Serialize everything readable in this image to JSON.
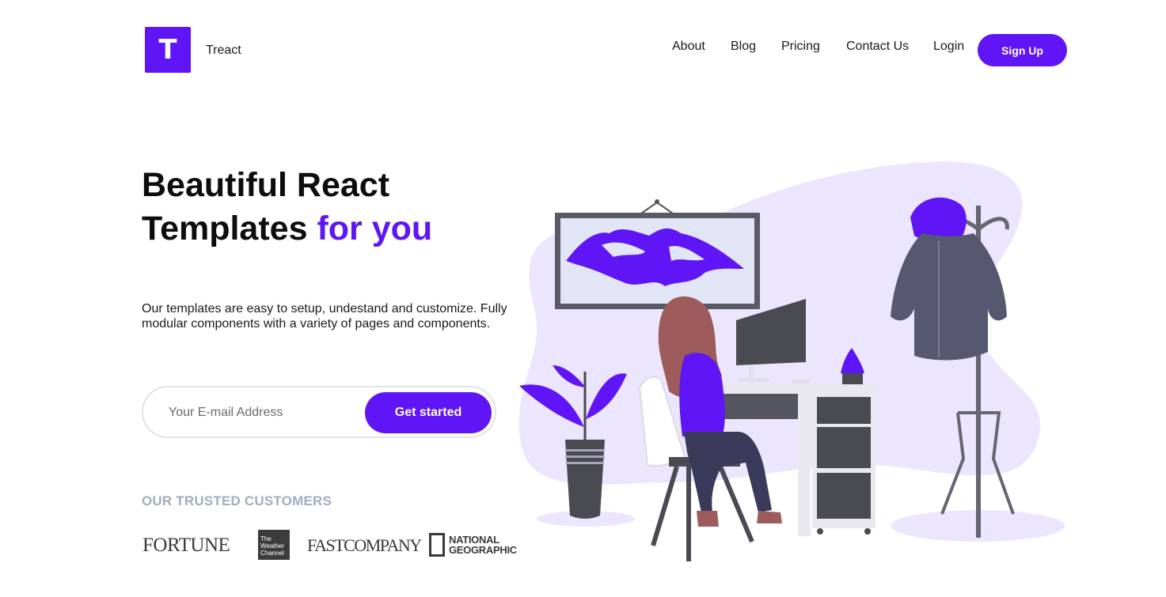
{
  "brand": {
    "logo_letter": "T",
    "name": "Treact"
  },
  "nav": {
    "links": [
      "About",
      "Blog",
      "Pricing",
      "Contact Us",
      "Login"
    ],
    "signup_label": "Sign Up"
  },
  "hero": {
    "title_line1": "Beautiful React",
    "title_line2_plain": "Templates ",
    "title_line2_accent": "for you",
    "description": "Our templates are easy to setup, undestand and customize. Fully modular components with a variety of pages and components.",
    "email_placeholder": "Your E-mail Address",
    "cta_label": "Get started"
  },
  "customers": {
    "heading": "OUR TRUSTED CUSTOMERS",
    "logos": {
      "fortune": "FORTUNE",
      "weather_lines": [
        "The",
        "Weather",
        "Channel"
      ],
      "fastcompany": "FASTCOMPANY",
      "natgeo_lines": [
        "NATIONAL",
        "GEOGRAPHIC"
      ]
    }
  },
  "colors": {
    "accent": "#5f15f5",
    "muted_heading": "#a0aec0",
    "blob": "#ebe6fd"
  }
}
